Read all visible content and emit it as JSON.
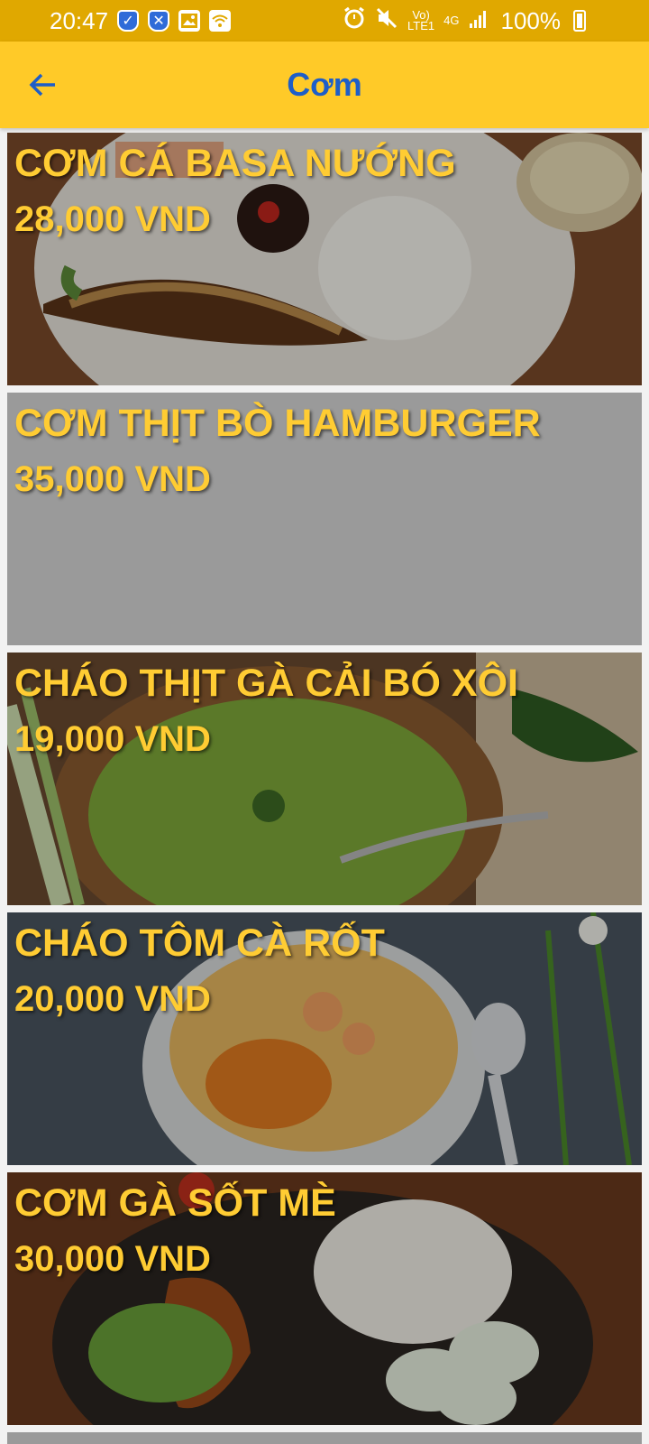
{
  "status_bar": {
    "time": "20:47",
    "battery": "100%",
    "network_top": "Vo)",
    "network_bottom": "LTE1",
    "signal": "4G"
  },
  "header": {
    "title": "Cơm",
    "back_icon": "arrow-left-icon"
  },
  "colors": {
    "status_bar": "#e0a800",
    "app_bar": "#ffca28",
    "title": "#1e5ec8",
    "item_text": "#ffcc33"
  },
  "menu": {
    "items": [
      {
        "name": "CƠM CÁ BASA NƯỚNG",
        "price": "28,000 VND",
        "image": "grilled-fish-rice-photo"
      },
      {
        "name": "CƠM THỊT BÒ HAMBURGER",
        "price": "35,000 VND",
        "image": ""
      },
      {
        "name": "CHÁO THỊT GÀ CẢI BÓ XÔI",
        "price": "19,000 VND",
        "image": "spinach-chicken-porridge-photo"
      },
      {
        "name": "CHÁO TÔM CÀ RỐT",
        "price": "20,000 VND",
        "image": "shrimp-carrot-porridge-photo"
      },
      {
        "name": "CƠM GÀ SỐT MÈ",
        "price": "30,000 VND",
        "image": "sesame-chicken-rice-photo"
      }
    ]
  }
}
